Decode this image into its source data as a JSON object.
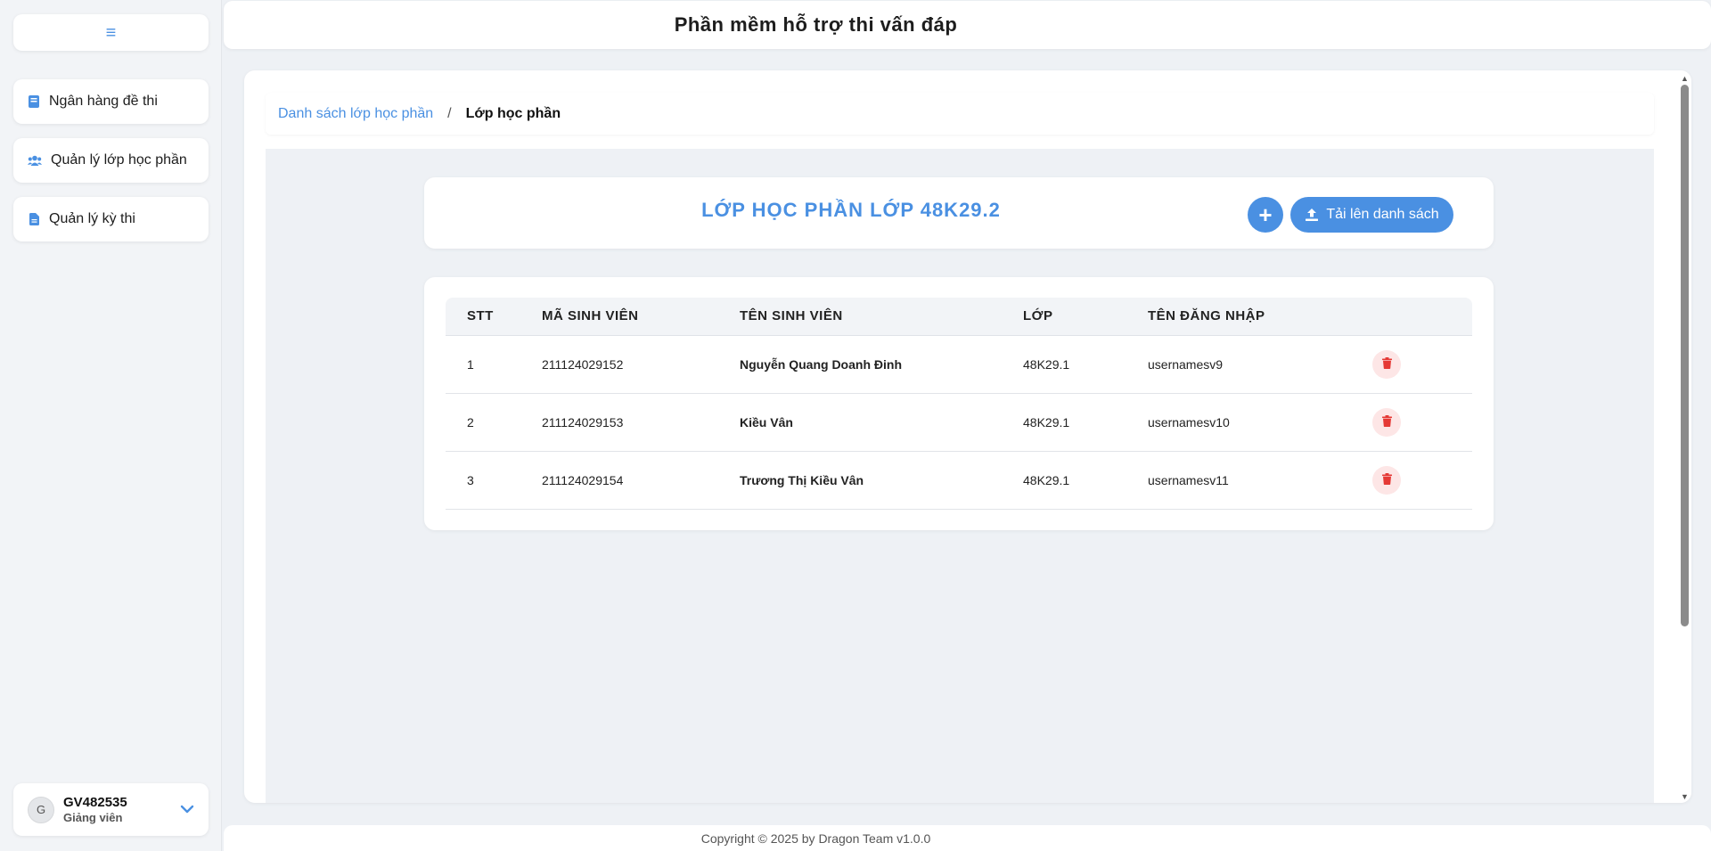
{
  "app": {
    "title": "Phần mềm hỗ trợ thi vấn đáp",
    "footer": "Copyright © 2025 by Dragon Team v1.0.0"
  },
  "sidebar": {
    "menu_icon": "hamburger-icon",
    "items": [
      {
        "label": "Ngân hàng đề thi",
        "icon": "book-icon"
      },
      {
        "label": "Quản lý lớp học phần",
        "icon": "users-icon"
      },
      {
        "label": "Quản lý kỳ thi",
        "icon": "document-icon"
      }
    ],
    "user": {
      "avatar_letter": "G",
      "name": "GV482535",
      "role": "Giảng viên"
    }
  },
  "breadcrumb": {
    "parent": "Danh sách lớp học phần",
    "separator": "/",
    "current": "Lớp học phần"
  },
  "class_panel": {
    "title": "LỚP HỌC PHẦN LỚP 48K29.2",
    "add_label": "+",
    "upload_label": "Tải lên danh sách"
  },
  "table": {
    "columns": [
      "STT",
      "MÃ SINH VIÊN",
      "TÊN SINH VIÊN",
      "LỚP",
      "TÊN ĐĂNG NHẬP"
    ],
    "rows": [
      {
        "stt": "1",
        "student_id": "211124029152",
        "name": "Nguyễn Quang Doanh Đinh",
        "class": "48K29.1",
        "username": "usernamesv9"
      },
      {
        "stt": "2",
        "student_id": "211124029153",
        "name": "Kiều Vân",
        "class": "48K29.1",
        "username": "usernamesv10"
      },
      {
        "stt": "3",
        "student_id": "211124029154",
        "name": "Trương Thị Kiều Vân",
        "class": "48K29.1",
        "username": "usernamesv11"
      }
    ]
  },
  "colors": {
    "accent": "#4a90e2",
    "danger": "#e53935",
    "danger_bg": "#fde6e6",
    "background": "#eef1f5"
  }
}
